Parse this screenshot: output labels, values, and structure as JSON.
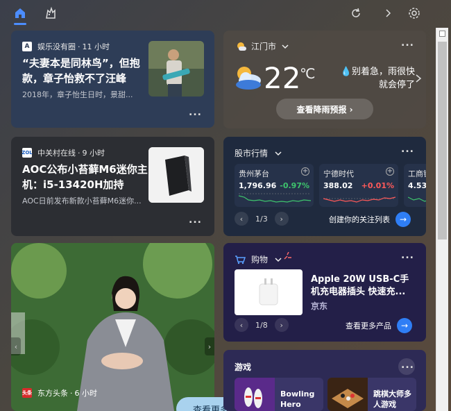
{
  "top_bar": {
    "icons": [
      "home-icon",
      "game-icon",
      "refresh-icon",
      "chevron-right-icon",
      "gear-icon"
    ]
  },
  "news1": {
    "source": "娱乐没有圈",
    "time": "11 小时",
    "title": "“夫妻本是同林鸟”，但抱款，章子怡救不了汪峰",
    "snippet": "2018年，章子怡生日时，景甜...",
    "more": "..."
  },
  "news2": {
    "source": "中关村在线",
    "time": "9 小时",
    "title": "AOC公布小苔藓M6迷你主机：i5-13420H加持",
    "snippet": "AOC日前发布新款小苔藓M6迷你...",
    "more": "..."
  },
  "weather": {
    "location": "江门市",
    "temperature": "22",
    "unit": "℃",
    "message": "别着急，雨很快就会停了",
    "button": "查看降雨预报 ›",
    "more": "..."
  },
  "stocks": {
    "title": "股市行情",
    "items": [
      {
        "name": "贵州茅台",
        "price": "1,796.96",
        "change": "-0.97%",
        "color": "#3ec46d"
      },
      {
        "name": "宁德时代",
        "price": "388.02",
        "change": "+0.01%",
        "color": "#ff5a5a"
      },
      {
        "name": "工商银",
        "price": "4.53",
        "change": "",
        "color": "#3ec46d"
      }
    ],
    "page": "1/3",
    "link": "创建你的关注列表",
    "more": "..."
  },
  "photo_card": {
    "source": "东方头条",
    "time": "6 小时",
    "more_button": "查看更多 ›"
  },
  "shopping": {
    "title": "购物",
    "product": "Apple 20W USB-C手机充电器插头 快速充...",
    "store": "京东",
    "page": "1/8",
    "link": "查看更多产品",
    "more": "..."
  },
  "games": {
    "title": "游戏",
    "items": [
      {
        "name": "Bowling Hero"
      },
      {
        "name": "跳棋大师多人游戏"
      }
    ],
    "more": "..."
  }
}
